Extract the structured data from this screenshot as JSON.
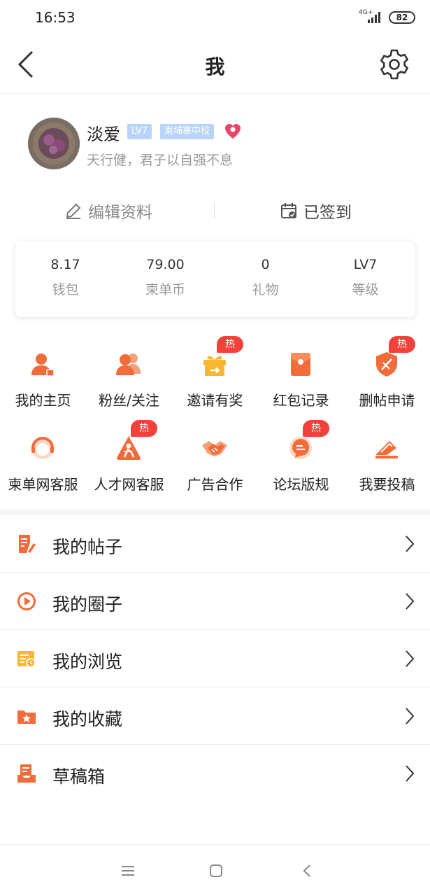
{
  "status_bar": {
    "time": "16:53",
    "network": "4G+",
    "battery": "82"
  },
  "nav": {
    "title": "我",
    "back_icon": "back-arrow-icon",
    "settings_icon": "gear-icon"
  },
  "profile": {
    "username": "淡爱",
    "level_badge": "LV7",
    "school_badge": "柬埔寨中校",
    "signature": "天行健，君子以自强不息"
  },
  "actions": {
    "edit": "编辑资料",
    "checkin": "已签到"
  },
  "stats": [
    {
      "value": "8.17",
      "label": "钱包"
    },
    {
      "value": "79.00",
      "label": "柬单币"
    },
    {
      "value": "0",
      "label": "礼物"
    },
    {
      "value": "LV7",
      "label": "等级"
    }
  ],
  "grid": [
    {
      "label": "我的主页",
      "icon": "user-home-icon",
      "hot": ""
    },
    {
      "label": "粉丝/关注",
      "icon": "fans-icon",
      "hot": ""
    },
    {
      "label": "邀请有奖",
      "icon": "gift-icon",
      "hot": "热"
    },
    {
      "label": "红包记录",
      "icon": "red-packet-icon",
      "hot": ""
    },
    {
      "label": "删帖申请",
      "icon": "delete-post-icon",
      "hot": "热"
    },
    {
      "label": "柬单网客服",
      "icon": "customer-service-icon",
      "hot": ""
    },
    {
      "label": "人才网客服",
      "icon": "talent-service-icon",
      "hot": "热"
    },
    {
      "label": "广告合作",
      "icon": "handshake-icon",
      "hot": ""
    },
    {
      "label": "论坛版规",
      "icon": "forum-rules-icon",
      "hot": "热"
    },
    {
      "label": "我要投稿",
      "icon": "submit-icon",
      "hot": ""
    }
  ],
  "menu": [
    {
      "label": "我的帖子",
      "icon": "posts-icon"
    },
    {
      "label": "我的圈子",
      "icon": "circle-icon"
    },
    {
      "label": "我的浏览",
      "icon": "history-icon"
    },
    {
      "label": "我的收藏",
      "icon": "favorites-icon"
    },
    {
      "label": "草稿箱",
      "icon": "drafts-icon"
    }
  ],
  "colors": {
    "accent": "#f26b3a",
    "hot": "#f2413b",
    "badge": "#b9d4f6",
    "heart": "#e8476a",
    "yellow": "#f7b733"
  }
}
